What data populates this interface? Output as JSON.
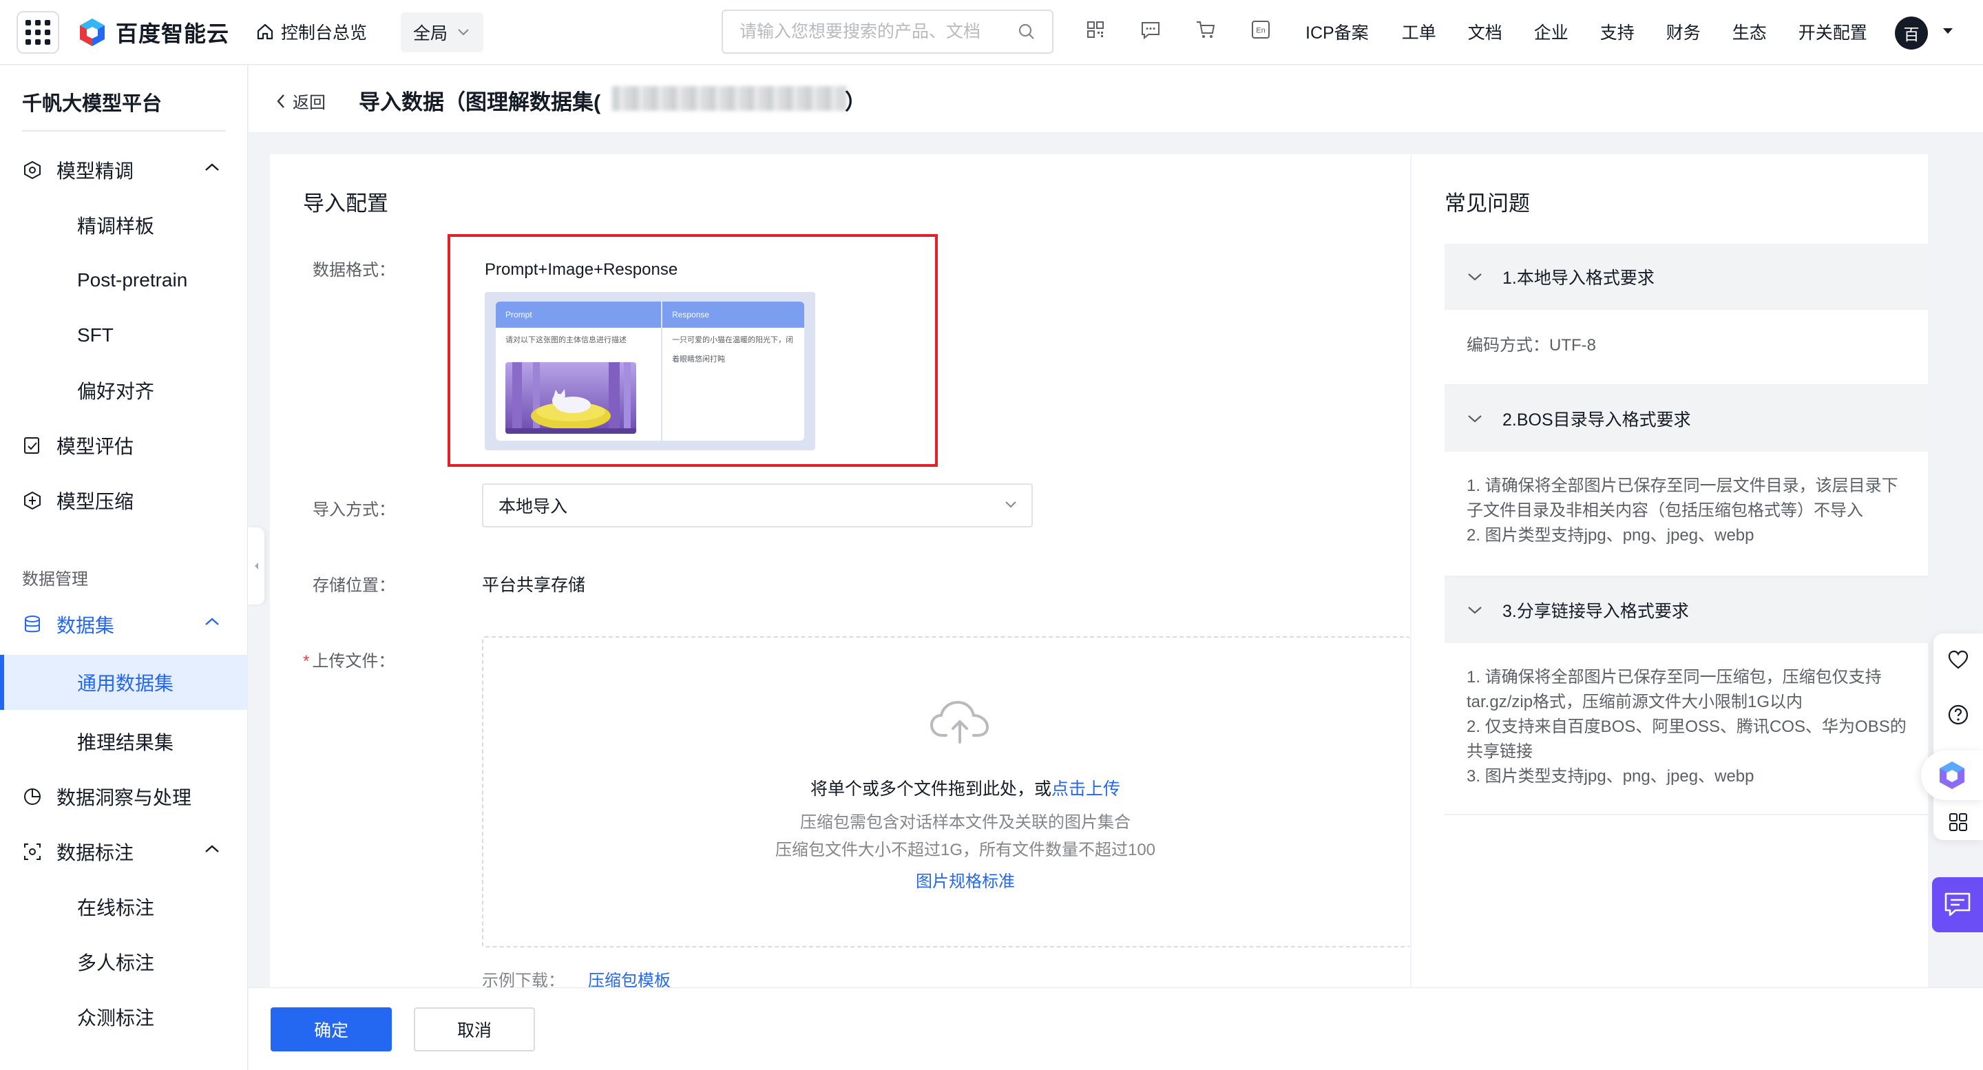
{
  "topbar": {
    "brand": "百度智能云",
    "console_link": "控制台总览",
    "region": "全局",
    "search_placeholder": "请输入您想要搜索的产品、文档",
    "icons": [
      "qrcode-icon",
      "message-icon",
      "cart-icon",
      "language-en-icon"
    ],
    "lang_label": "En",
    "nav_items": [
      "ICP备案",
      "工单",
      "文档",
      "企业",
      "支持",
      "财务",
      "生态",
      "开关配置"
    ],
    "avatar_text": "百"
  },
  "sidebar": {
    "title": "千帆大模型平台",
    "groups": {
      "finetune": "模型精调",
      "finetune_items": [
        "精调样板",
        "Post-pretrain",
        "SFT",
        "偏好对齐"
      ],
      "evaluate": "模型评估",
      "compress": "模型压缩",
      "section_data": "数据管理",
      "dataset": "数据集",
      "dataset_items": [
        "通用数据集",
        "推理结果集"
      ],
      "insight": "数据洞察与处理",
      "annotate": "数据标注",
      "annotate_items": [
        "在线标注",
        "多人标注",
        "众测标注"
      ]
    },
    "active_item": "通用数据集"
  },
  "header": {
    "back_label": "返回",
    "title": "导入数据（图理解数据集(",
    "title_end": "）"
  },
  "form": {
    "section_title": "导入配置",
    "format_label": "数据格式：",
    "format_value": "Prompt+Image+Response",
    "preview": {
      "col_prompt": "Prompt",
      "col_response": "Response",
      "prompt_text": "请对以下这张图的主体信息进行描述",
      "response_text_1": "一只可爱的小猫在温暖的阳光下，闭",
      "response_text_2": "着眼睛悠闲打盹"
    },
    "import_method_label": "导入方式：",
    "import_method_value": "本地导入",
    "storage_label": "存储位置：",
    "storage_value": "平台共享存储",
    "upload_label": "上传文件：",
    "upload_main": "将单个或多个文件拖到此处，或",
    "upload_link": "点击上传",
    "upload_hint_1": "压缩包需包含对话样本文件及关联的图片集合",
    "upload_hint_2": "压缩包文件大小不超过1G，所有文件数量不超过100",
    "upload_spec_link": "图片规格标准",
    "example_label": "示例下载：",
    "example_link": "压缩包模板"
  },
  "faq": {
    "title": "常见问题",
    "q1": "1.本地导入格式要求",
    "a1": "编码方式：UTF-8",
    "q2": "2.BOS目录导入格式要求",
    "a2_1": "1. 请确保将全部图片已保存至同一层文件目录，该层目录下",
    "a2_2": "子文件目录及非相关内容（包括压缩包格式等）不导入",
    "a2_3": "2. 图片类型支持jpg、png、jpeg、webp",
    "q3": "3.分享链接导入格式要求",
    "a3_1": "1. 请确保将全部图片已保存至同一压缩包，压缩包仅支持",
    "a3_2": "tar.gz/zip格式，压缩前源文件大小限制1G以内",
    "a3_3": "2. 仅支持来自百度BOS、阿里OSS、腾讯COS、华为OBS的",
    "a3_4": "共享链接",
    "a3_5": "3. 图片类型支持jpg、png、jpeg、webp"
  },
  "footer": {
    "confirm": "确定",
    "cancel": "取消"
  },
  "colors": {
    "primary": "#2468f2",
    "highlight_border": "#e3202a",
    "chat_button": "#6b4ef6"
  }
}
